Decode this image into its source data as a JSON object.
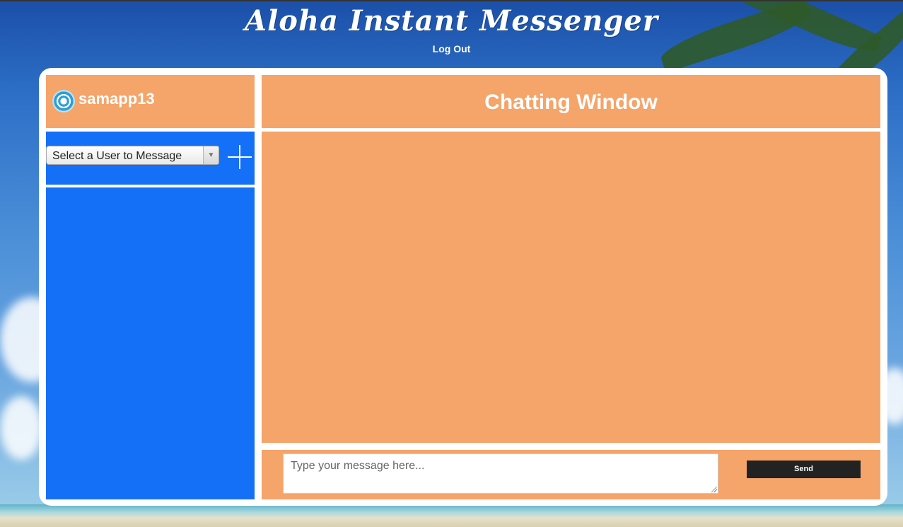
{
  "app": {
    "title": "Aloha Instant Messenger",
    "logout_label": "Log Out"
  },
  "sidebar": {
    "username": "samapp13",
    "user_select": {
      "selected": "Select a User to Message"
    },
    "add_icon": "plus-icon"
  },
  "chat": {
    "title": "Chatting Window",
    "message_placeholder": "Type your message here...",
    "send_label": "Send"
  },
  "colors": {
    "header_orange": "#f5a46a",
    "sidebar_blue": "#1470f7",
    "send_button": "#222222"
  }
}
